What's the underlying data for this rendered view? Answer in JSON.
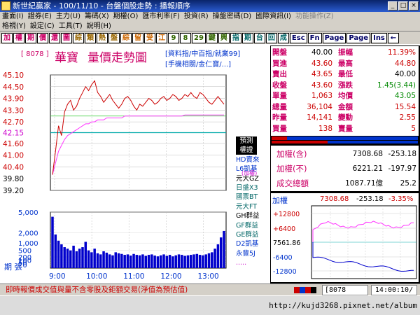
{
  "window": {
    "title": "新世紀贏家 - 100/11/10 - 台盤個股走勢 : 播報順序",
    "buttons": [
      "_",
      "□",
      "×"
    ]
  },
  "menu1": [
    "畫面(I)",
    "證券(E)",
    "主力(U)",
    "籌碼(X)",
    "期權(O)",
    "匯市利率(F)",
    "投資(R)",
    "操盤密碼(D)",
    "國際資訊(I)",
    "功能操作(Z)"
  ],
  "menu2": [
    "格視(Y)",
    "設定(C)",
    "工具(T)",
    "說明(H)"
  ],
  "toolbar": [
    {
      "label": "加",
      "color": "#cc0066"
    },
    {
      "label": "權",
      "color": "#cc0066"
    },
    {
      "label": "期",
      "color": "#cc0066"
    },
    {
      "label": "價",
      "color": "#cc0066"
    },
    {
      "label": "還",
      "color": "#cc0066"
    },
    {
      "label": "圖",
      "color": "#cc0066"
    },
    {
      "label": "綜",
      "color": "#996600"
    },
    {
      "label": "類",
      "color": "#996600"
    },
    {
      "label": "熱",
      "color": "#996600"
    },
    {
      "label": "盤",
      "color": "#996600"
    },
    {
      "label": "綜",
      "color": "#cc6600"
    },
    {
      "label": "留",
      "color": "#cc6600"
    },
    {
      "label": "受",
      "color": "#cc6600"
    },
    {
      "label": "江",
      "color": "#cc6600"
    },
    {
      "label": "9",
      "color": "#336600"
    },
    {
      "label": "8",
      "color": "#336600"
    },
    {
      "label": "29",
      "color": "#336600"
    },
    {
      "label": "鍵",
      "color": "#336600"
    },
    {
      "label": "興",
      "color": "#336600"
    },
    {
      "label": "指",
      "color": "#006666"
    },
    {
      "label": "期",
      "color": "#006666"
    },
    {
      "label": "台",
      "color": "#006666"
    },
    {
      "label": "回",
      "color": "#006666"
    },
    {
      "label": "成",
      "color": "#006666"
    },
    {
      "label": "Esc",
      "color": "#000066"
    },
    {
      "label": "Fn",
      "color": "#000066"
    },
    {
      "label": "Page",
      "color": "#000066"
    },
    {
      "label": "Page",
      "color": "#000066"
    },
    {
      "label": "Ins",
      "color": "#000066"
    },
    {
      "label": "←",
      "color": "#000066"
    }
  ],
  "stock": {
    "code": "[ 8078 ]",
    "name": "華寶",
    "chart_title": "量價走勢圖",
    "links_line1": "[資料指/中百指/就業99]",
    "links_line2": "[手機相關/金仁寶/...]"
  },
  "quote": {
    "rows": [
      {
        "l1": "開盤",
        "v1": "40.00",
        "c1": "#000000",
        "l2": "振幅",
        "v2": "11.39%",
        "c2": "#cc0000"
      },
      {
        "l1": "買進",
        "v1": "43.60",
        "c1": "#cc0000",
        "l2": "最高",
        "v2": "44.80",
        "c2": "#cc0000"
      },
      {
        "l1": "賣出",
        "v1": "43.65",
        "c1": "#cc0000",
        "l2": "最低",
        "v2": "40.00",
        "c2": "#000000"
      },
      {
        "l1": "收盤",
        "v1": "43.60",
        "c1": "#cc0000",
        "l2": "漲跌",
        "v2": "1.45(3.44)",
        "c2": "#008800"
      },
      {
        "l1": "單量",
        "v1": "1,063",
        "c1": "#cc0000",
        "l2": "均價",
        "v2": "43.05",
        "c2": "#008800"
      },
      {
        "l1": "總量",
        "v1": "36,104",
        "c1": "#cc0000",
        "l2": "金額",
        "v2": "15.54",
        "c2": "#cc0000"
      },
      {
        "l1": "昨量",
        "v1": "14,141",
        "c1": "#cc0000",
        "l2": "變動",
        "v2": "2.55",
        "c2": "#cc0000"
      },
      {
        "l1": "買量",
        "v1": "138",
        "c1": "#cc0000",
        "l2": "賣量",
        "v2": "5",
        "c2": "#cc0000"
      }
    ]
  },
  "index_panel": [
    {
      "label": "加權(含)",
      "value": "7308.68",
      "change": "-253.18"
    },
    {
      "label": "加權(不)",
      "value": "6221.21",
      "change": "-197.97"
    },
    {
      "label": "成交總額",
      "value": "1087.71億",
      "change": "25.2"
    }
  ],
  "mini": {
    "label": "加權",
    "value": "7308.68",
    "change": "-253.18",
    "pct": "-3.35%",
    "yticks": [
      "+12800",
      "+6400",
      "7561.86",
      "-6400",
      "-12800"
    ]
  },
  "side_labels": [
    {
      "text": "預測",
      "color": "#ffffff",
      "bg": "#000000"
    },
    {
      "text": "權證",
      "color": "#ffffff",
      "bg": "#000000"
    },
    {
      "text": "HD寶來",
      "color": "#0033cc",
      "bg": ""
    },
    {
      "text": "L6凱基",
      "color": "#0033cc",
      "bg": ""
    },
    {
      "text": "元大GZ",
      "color": "#000000",
      "bg": ""
    },
    {
      "text": "日盛X3",
      "color": "#006666",
      "bg": ""
    },
    {
      "text": "國票BT",
      "color": "#006666",
      "bg": ""
    },
    {
      "text": "元大FT",
      "color": "#006666",
      "bg": ""
    },
    {
      "text": "GH群益",
      "color": "#000000",
      "bg": ""
    },
    {
      "text": "GF群益",
      "color": "#006666",
      "bg": ""
    },
    {
      "text": "GE群益",
      "color": "#006666",
      "bg": ""
    },
    {
      "text": "D2凱基",
      "color": "#0033cc",
      "bg": ""
    },
    {
      "text": "永豐5J",
      "color": "#0033cc",
      "bg": ""
    },
    {
      "text": ".....",
      "color": "#cc00cc",
      "bg": ""
    }
  ],
  "price_axis_small_label": "(加權)",
  "chart_data": {
    "type": "line",
    "price_yticks": [
      "45.10",
      "44.50",
      "43.90",
      "43.30",
      "42.70",
      "42.15",
      "41.60",
      "41.00",
      "40.40",
      "39.80",
      "39.20"
    ],
    "volume_yticks": [
      "5,000",
      "2,000",
      "1,000",
      "500",
      "200",
      "100",
      "50",
      "20"
    ],
    "volume_axis_label": "期  張",
    "xticks": [
      "9:00",
      "10:00",
      "11:00",
      "12:00",
      "13:00"
    ],
    "reference_price": 42.15,
    "price_series": [
      40.0,
      41.2,
      42.5,
      42.0,
      43.2,
      43.6,
      43.8,
      43.3,
      43.5,
      43.9,
      44.2,
      44.5,
      44.3,
      44.6,
      44.8,
      44.2,
      44.0,
      43.7,
      43.9,
      44.1,
      43.8,
      43.6,
      43.4,
      43.6,
      43.9,
      44.0,
      43.8,
      43.5,
      43.3,
      43.6,
      43.5,
      43.7,
      43.9,
      43.8,
      43.6,
      43.7,
      43.9,
      44.0,
      43.8,
      43.9,
      44.1,
      44.0,
      43.8,
      43.9,
      44.1,
      44.0,
      44.2,
      44.0,
      43.9,
      44.2,
      44.1,
      43.9,
      43.7,
      43.6,
      43.8,
      44.0,
      43.8,
      43.6
    ],
    "avg_series": [
      40.0,
      40.6,
      41.2,
      41.5,
      41.8,
      42.0,
      42.1,
      42.2,
      42.3,
      42.4,
      42.5,
      42.6,
      42.6,
      42.7,
      42.7,
      42.8,
      42.8,
      42.8,
      42.9,
      42.9,
      42.9,
      42.9,
      42.9,
      42.9,
      43.0,
      43.0,
      43.0,
      43.0,
      43.0,
      43.0,
      43.0,
      43.0,
      43.0,
      43.0,
      43.0,
      43.0,
      43.0,
      43.0,
      43.0,
      43.0,
      43.0,
      43.0,
      43.0,
      43.0,
      43.05,
      43.05,
      43.05,
      43.05,
      43.05,
      43.05,
      43.05,
      43.05,
      43.05,
      43.05,
      43.05,
      43.05,
      43.05,
      43.05
    ],
    "volume_series": [
      4200,
      1800,
      1200,
      900,
      700,
      600,
      500,
      800,
      450,
      600,
      700,
      1100,
      500,
      400,
      600,
      350,
      300,
      450,
      380,
      300,
      260,
      400,
      350,
      320,
      280,
      300,
      250,
      320,
      280,
      260,
      300,
      240,
      280,
      300,
      250,
      220,
      260,
      300,
      240,
      280,
      220,
      260,
      300,
      280,
      240,
      260,
      280,
      300,
      320,
      280,
      260,
      300,
      350,
      400,
      600,
      900,
      1500,
      2200
    ]
  }
}
